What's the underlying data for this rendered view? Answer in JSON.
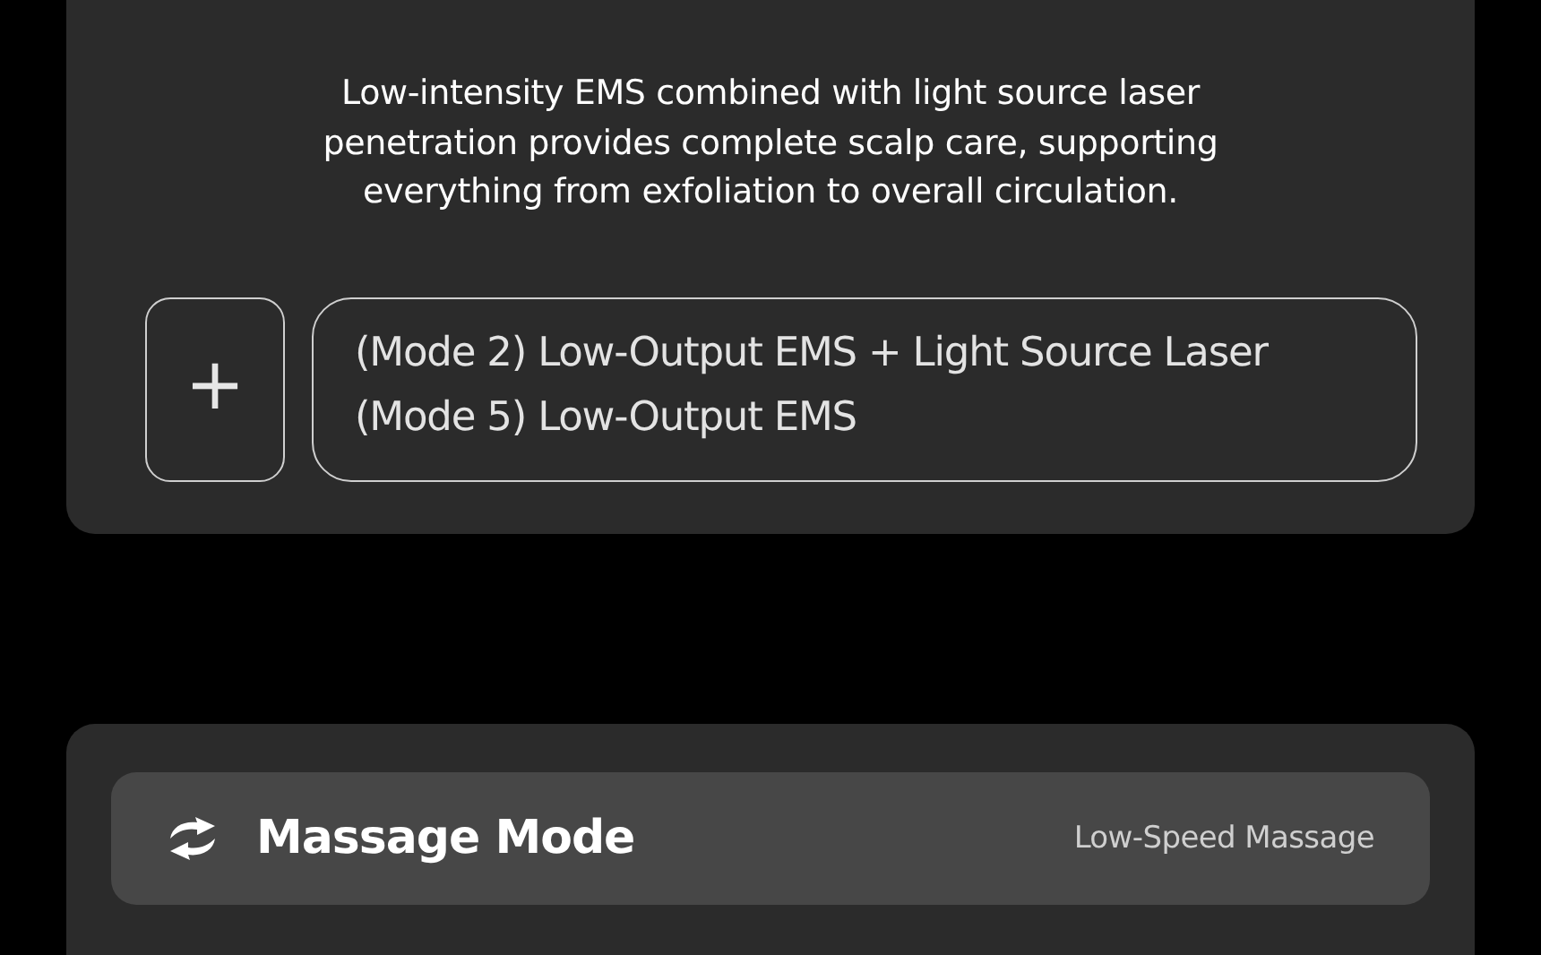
{
  "description": "Low-intensity EMS combined with light source laser penetration provides complete scalp care, supporting everything from exfoliation to overall circulation.",
  "add_button": {
    "label": "+"
  },
  "modes": [
    "(Mode 2) Low-Output EMS + Light Source Laser",
    "(Mode 5) Low-Output EMS"
  ],
  "massage": {
    "title": "Massage Mode",
    "value": "Low-Speed Massage"
  }
}
